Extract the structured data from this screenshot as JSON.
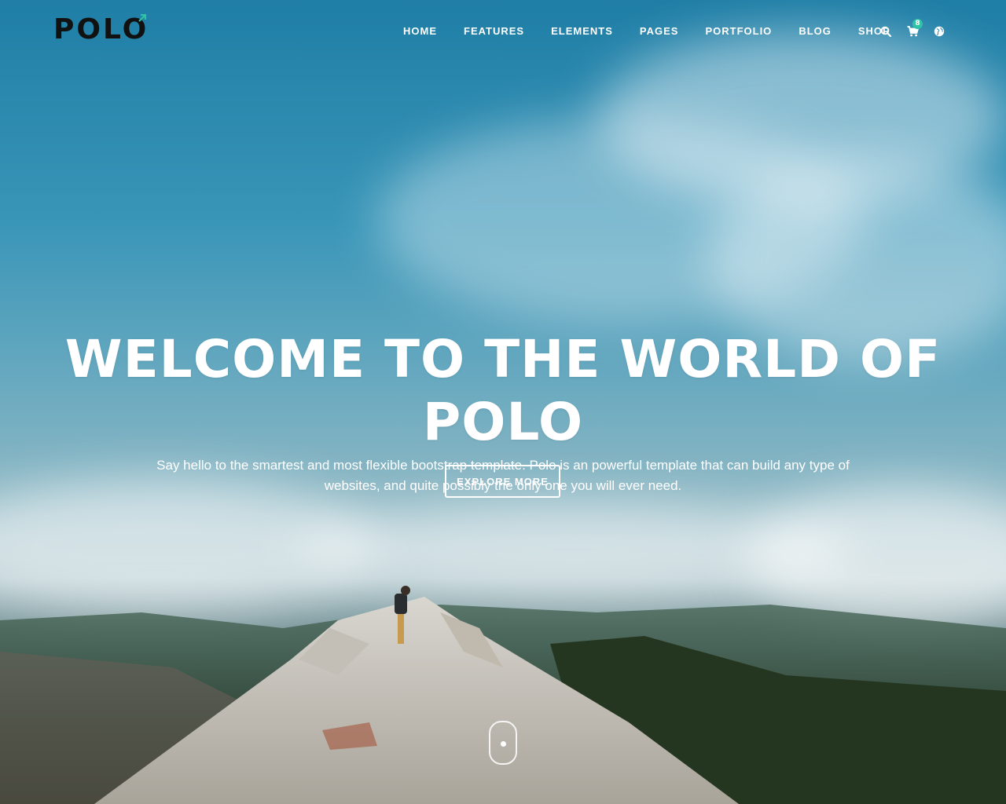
{
  "brand": {
    "logo_text": "POLO",
    "accent_color": "#2ec4a4"
  },
  "nav": {
    "items": [
      "HOME",
      "FEATURES",
      "ELEMENTS",
      "PAGES",
      "PORTFOLIO",
      "BLOG",
      "SHOP"
    ],
    "icons": [
      "search-icon",
      "cart-icon",
      "globe-icon"
    ],
    "cart_count": "8"
  },
  "hero": {
    "title": "WELCOME TO THE WORLD OF POLO",
    "subtitle": "Say hello to the smartest and most flexible bootstrap template. Polo is an powerful template that can build any type of websites, and quite possibly the only one you will ever need.",
    "button_label": "EXPLORE MORE"
  },
  "colors": {
    "sky_top": "#1f7ea6",
    "text": "#ffffff",
    "logo": "#111111"
  }
}
